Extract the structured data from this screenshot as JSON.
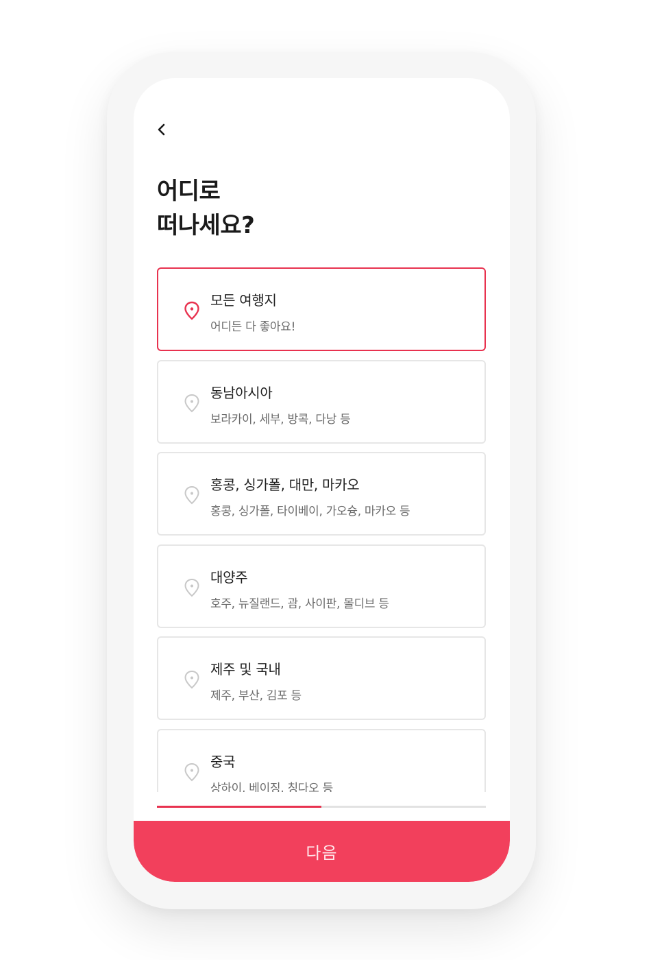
{
  "header": {
    "back_icon": "chevron-left-icon",
    "title_line1": "어디로",
    "title_line2": "떠나세요?"
  },
  "destinations": [
    {
      "title": "모든 여행지",
      "subtitle": "어디든 다 좋아요!",
      "selected": true,
      "icon": "location-pin-icon"
    },
    {
      "title": "동남아시아",
      "subtitle": "보라카이, 세부, 방콕, 다낭 등",
      "selected": false,
      "icon": "location-pin-icon"
    },
    {
      "title": "홍콩, 싱가폴, 대만, 마카오",
      "subtitle": "홍콩, 싱가폴, 타이베이, 가오슝, 마카오 등",
      "selected": false,
      "icon": "location-pin-icon"
    },
    {
      "title": "대양주",
      "subtitle": "호주, 뉴질랜드, 괌, 사이판, 몰디브 등",
      "selected": false,
      "icon": "location-pin-icon"
    },
    {
      "title": "제주 및 국내",
      "subtitle": "제주, 부산, 김포 등",
      "selected": false,
      "icon": "location-pin-icon"
    },
    {
      "title": "중국",
      "subtitle": "상하이, 베이징, 칭다오 등",
      "selected": false,
      "icon": "location-pin-icon"
    }
  ],
  "progress": {
    "value": 0.5
  },
  "footer": {
    "next_label": "다음"
  },
  "colors": {
    "accent": "#e8324f",
    "button": "#f2405c",
    "border": "#e6e6e6",
    "inactive_icon": "#c8c8c8"
  }
}
